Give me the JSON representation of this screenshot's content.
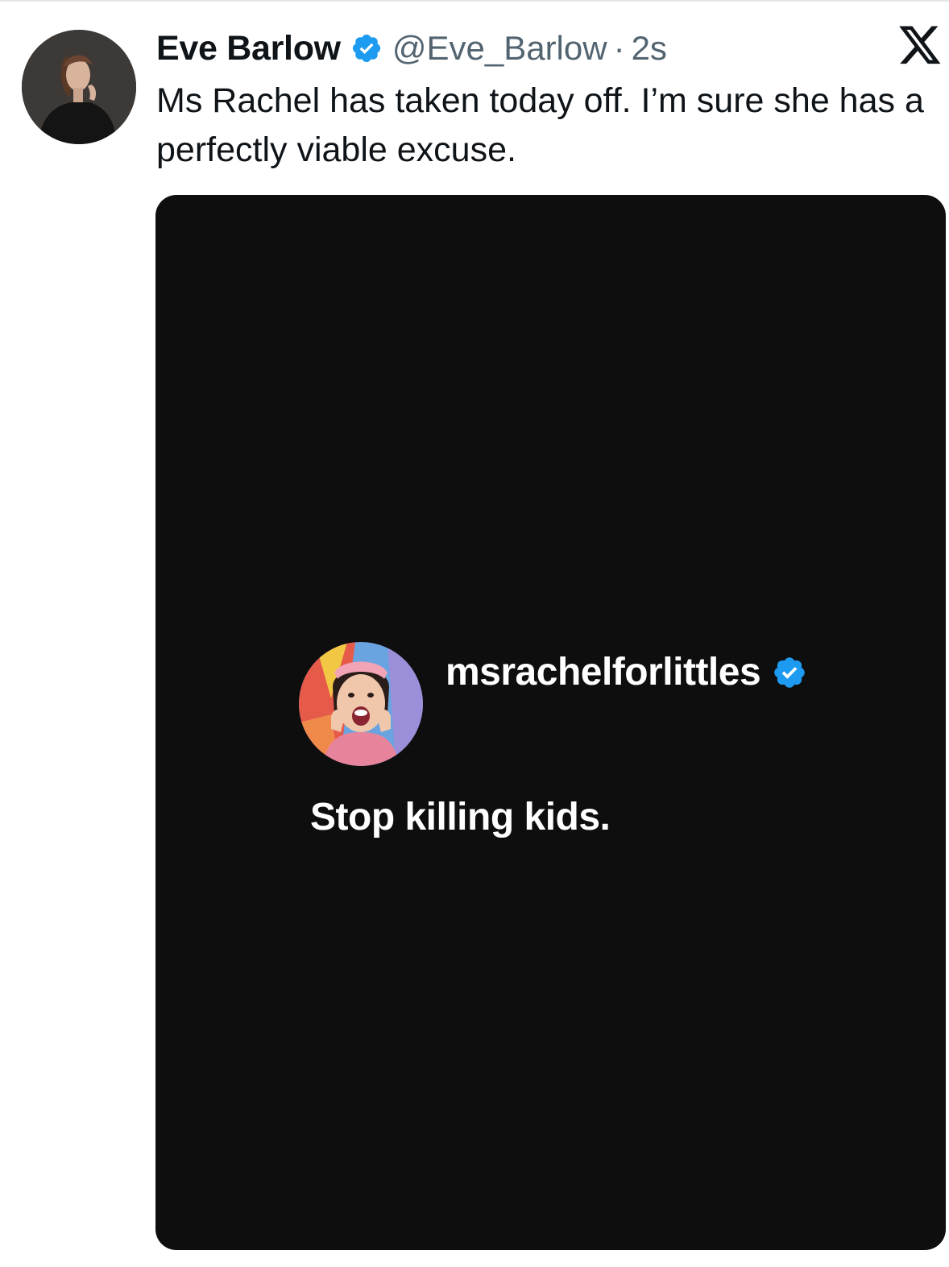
{
  "tweet": {
    "author": {
      "display_name": "Eve Barlow",
      "handle": "@Eve_Barlow",
      "verified": true
    },
    "separator": "·",
    "time": "2s",
    "text": "Ms Rachel has taken today off. I’m sure she has a perfectly viable excuse."
  },
  "media": {
    "embedded_post": {
      "username": "msrachelforlittles",
      "verified": true,
      "text": "Stop killing kids."
    }
  },
  "icons": {
    "verified_badge": "verified-check-icon",
    "platform_logo": "x-logo-icon"
  },
  "colors": {
    "verified_blue": "#1d9bf0",
    "text_primary": "#0f1419",
    "text_secondary": "#536471",
    "media_background": "#0e0e0f"
  }
}
